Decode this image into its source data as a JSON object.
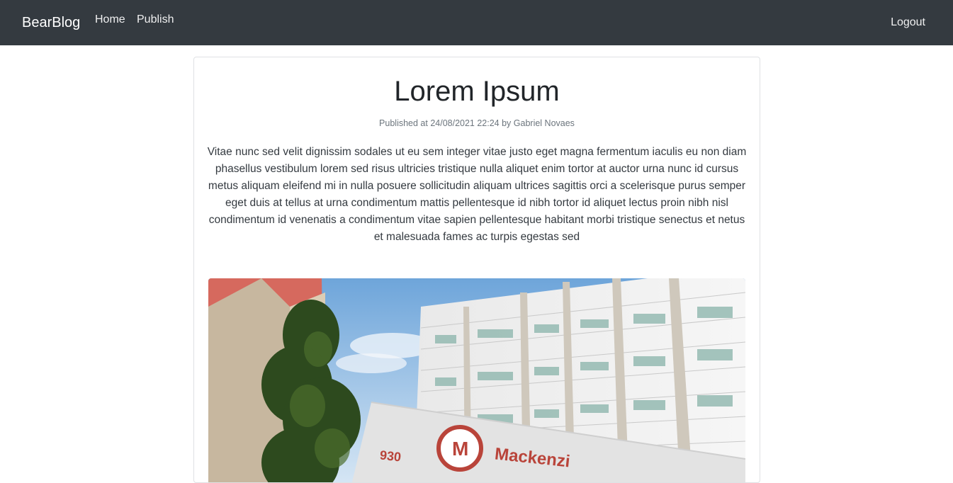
{
  "navbar": {
    "brand": "BearBlog",
    "links": [
      {
        "label": "Home"
      },
      {
        "label": "Publish"
      }
    ],
    "logout_label": "Logout",
    "background": "#343a40"
  },
  "post": {
    "title": "Lorem Ipsum",
    "meta": "Published at 24/08/2021 22:24 by Gabriel Novaes",
    "body": "Vitae nunc sed velit dignissim sodales ut eu sem integer vitae justo eget magna fermentum iaculis eu non diam phasellus vestibulum lorem sed risus ultricies tristique nulla aliquet enim tortor at auctor urna nunc id cursus metus aliquam eleifend mi in nulla posuere sollicitudin aliquam ultrices sagittis orci a scelerisque purus semper eget duis at tellus at urna condimentum mattis pellentesque id nibh tortor id aliquet lectus proin nibh nisl condimentum id venenatis a condimentum vitae sapien pellentesque habitant morbi tristique senectus et netus et malesuada fames ac turpis egestas sed",
    "image": {
      "sign_number": "930",
      "sign_logo": "M",
      "sign_text": "Mackenzi"
    }
  }
}
